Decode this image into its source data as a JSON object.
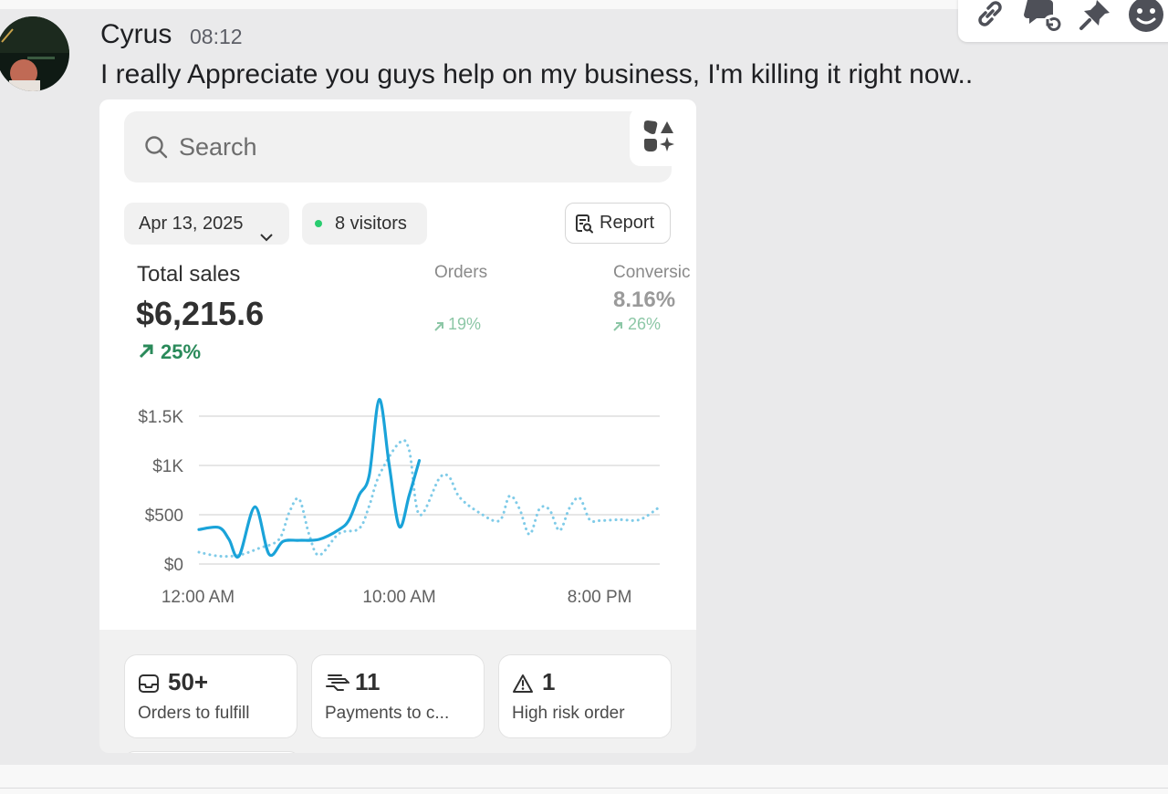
{
  "message": {
    "author": "Cyrus",
    "timestamp": "08:12",
    "text": "I really Appreciate you guys help on my business, I'm killing it right now.."
  },
  "toolbar": {
    "icons": [
      "link-icon",
      "reply-thread-icon",
      "pin-icon",
      "emoji-icon"
    ]
  },
  "dashboard": {
    "search_placeholder": "Search",
    "date": "Apr 13, 2025",
    "visitors": "8 visitors",
    "report_label": "Report",
    "metrics": {
      "total_sales": {
        "label": "Total sales",
        "value": "$6,215.6",
        "delta": "25%"
      },
      "orders": {
        "label": "Orders",
        "delta": "19%"
      },
      "conversion": {
        "label": "Conversic",
        "value": "8.16%",
        "delta": "26%"
      }
    },
    "tiles": [
      {
        "value": "50+",
        "caption": "Orders to fulfill",
        "icon": "inbox-icon"
      },
      {
        "value": "11",
        "caption": "Payments to c...",
        "icon": "payment-icon"
      },
      {
        "value": "1",
        "caption": "High risk order",
        "icon": "warning-icon"
      }
    ]
  },
  "colors": {
    "accent_line": "#1aa3d9",
    "compare_line": "#7fcbe8",
    "positive": "#2a8a5a",
    "visitor_dot": "#29cc6f"
  },
  "chart_data": {
    "type": "line",
    "y_ticks": [
      "$1.5K",
      "$1K",
      "$500",
      "$0"
    ],
    "y_tick_values": [
      1500,
      1000,
      500,
      0
    ],
    "x_ticks": [
      "12:00 AM",
      "10:00 AM",
      "8:00 PM"
    ],
    "x_tick_hours": [
      0,
      10,
      20
    ],
    "ylim": [
      0,
      1500
    ],
    "xlim_hours": [
      0,
      23
    ],
    "grid": true,
    "series": [
      {
        "style": "solid",
        "x": [
          0,
          1,
          1.5,
          2,
          2.8,
          3.5,
          4.2,
          5,
          6,
          7,
          7.5,
          8,
          8.5,
          9,
          9.5,
          10,
          10.5,
          11
        ],
        "y": [
          350,
          370,
          250,
          80,
          580,
          100,
          230,
          240,
          250,
          350,
          450,
          700,
          900,
          1670,
          1000,
          380,
          700,
          1050
        ]
      },
      {
        "style": "dotted",
        "x": [
          0,
          1,
          2,
          3,
          4,
          4.5,
          5,
          5.5,
          6,
          7,
          8,
          8.5,
          9,
          10,
          10.5,
          11,
          12,
          12.5,
          13,
          14,
          15,
          15.5,
          16,
          16.5,
          17,
          17.5,
          18,
          18.5,
          19,
          19.5,
          20,
          21,
          22,
          23
        ],
        "y": [
          120,
          80,
          90,
          160,
          250,
          520,
          660,
          300,
          90,
          310,
          360,
          590,
          900,
          1230,
          1150,
          500,
          870,
          880,
          680,
          520,
          440,
          690,
          560,
          300,
          560,
          550,
          340,
          570,
          670,
          450,
          440,
          450,
          450,
          580
        ]
      }
    ]
  }
}
